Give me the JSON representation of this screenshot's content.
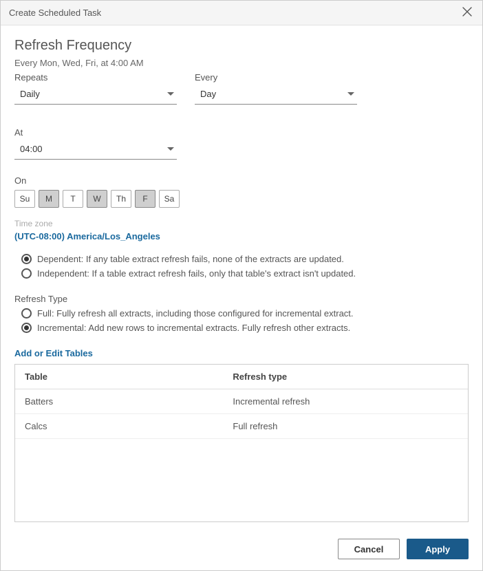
{
  "dialog": {
    "title": "Create Scheduled Task",
    "heading": "Refresh Frequency",
    "summary": "Every Mon, Wed, Fri, at 4:00 AM"
  },
  "repeats": {
    "label": "Repeats",
    "value": "Daily"
  },
  "every": {
    "label": "Every",
    "value": "Day"
  },
  "at": {
    "label": "At",
    "value": "04:00"
  },
  "on": {
    "label": "On",
    "days": [
      {
        "abbr": "Su",
        "selected": false
      },
      {
        "abbr": "M",
        "selected": true
      },
      {
        "abbr": "T",
        "selected": false
      },
      {
        "abbr": "W",
        "selected": true
      },
      {
        "abbr": "Th",
        "selected": false
      },
      {
        "abbr": "F",
        "selected": true
      },
      {
        "abbr": "Sa",
        "selected": false
      }
    ]
  },
  "timezone": {
    "label": "Time zone",
    "value": "(UTC-08:00) America/Los_Angeles"
  },
  "dependency": {
    "options": [
      {
        "label": "Dependent: If any table extract refresh fails, none of the extracts are updated.",
        "selected": true
      },
      {
        "label": "Independent: If a table extract refresh fails, only that table's extract isn't updated.",
        "selected": false
      }
    ]
  },
  "refresh_type": {
    "label": "Refresh Type",
    "options": [
      {
        "label": "Full: Fully refresh all extracts, including those configured for incremental extract.",
        "selected": false
      },
      {
        "label": "Incremental: Add new rows to incremental extracts. Fully refresh other extracts.",
        "selected": true
      }
    ]
  },
  "tables": {
    "link": "Add or Edit Tables",
    "headers": {
      "col1": "Table",
      "col2": "Refresh type"
    },
    "rows": [
      {
        "name": "Batters",
        "type": "Incremental refresh"
      },
      {
        "name": "Calcs",
        "type": "Full refresh"
      }
    ]
  },
  "footer": {
    "cancel": "Cancel",
    "apply": "Apply"
  }
}
